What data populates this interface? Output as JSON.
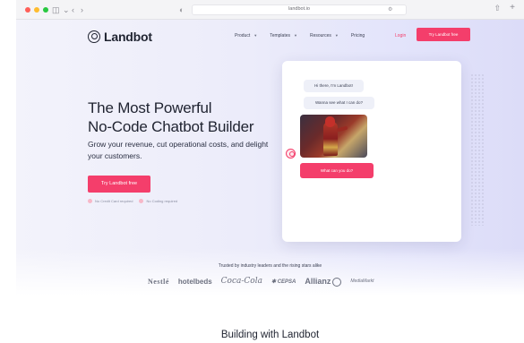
{
  "browser": {
    "url": "landbot.io",
    "colors": {
      "close": "#ff5f57",
      "minimize": "#febc2e",
      "maximize": "#28c840"
    }
  },
  "nav": {
    "logo": "Landbot",
    "menu": [
      {
        "label": "Product",
        "has_caret": true
      },
      {
        "label": "Templates",
        "has_caret": true
      },
      {
        "label": "Resources",
        "has_caret": true
      },
      {
        "label": "Pricing",
        "has_caret": false
      }
    ],
    "login": "Login",
    "cta": "Try Landbot free"
  },
  "hero": {
    "title_line1": "The Most Powerful",
    "title_line2": "No-Code Chatbot Builder",
    "subtitle": "Grow your revenue, cut operational costs, and delight your customers.",
    "cta": "Try Landbot free",
    "checks": [
      "No Credit Card required",
      "No Coding required"
    ]
  },
  "chat": {
    "bubble1": "Hi there, I'm Landbot!",
    "bubble2": "Wanna see what I can do?",
    "reply": "What can you do?"
  },
  "trusted": {
    "title": "Trusted by industry leaders and the rising stars alike",
    "brands": [
      "Nestlé",
      "hotelbeds",
      "Coca-Cola",
      "CEPSA",
      "Allianz",
      "MediaMarkt"
    ]
  },
  "section2": {
    "title": "Building with Landbot"
  },
  "colors": {
    "accent": "#f43e6b",
    "text": "#1f2330"
  }
}
